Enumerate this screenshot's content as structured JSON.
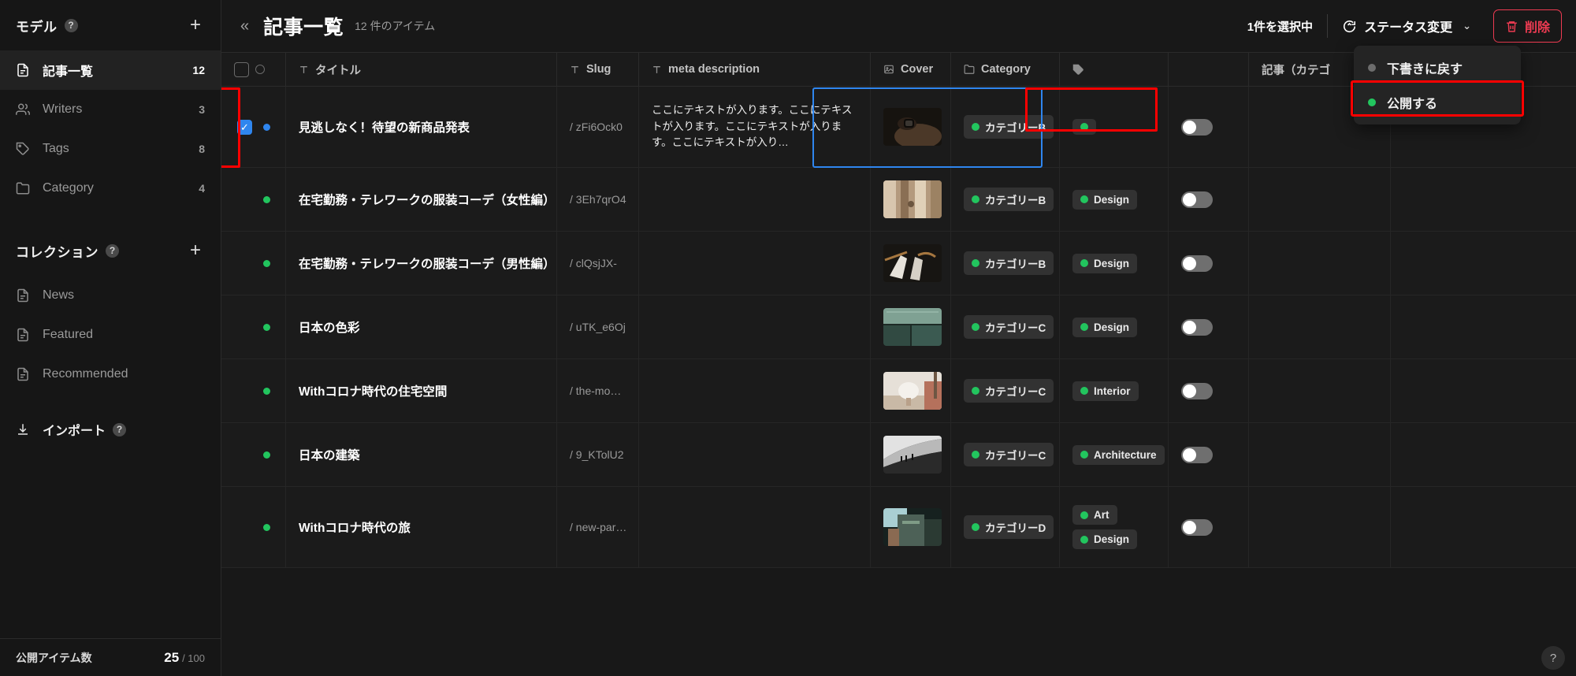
{
  "sidebar": {
    "model_section": {
      "title": "モデル",
      "help_icon": "?",
      "add_icon": "+",
      "items": [
        {
          "label": "記事一覧",
          "count": "12",
          "icon": "document-icon",
          "active": true
        },
        {
          "label": "Writers",
          "count": "3",
          "icon": "users-icon",
          "active": false
        },
        {
          "label": "Tags",
          "count": "8",
          "icon": "tag-icon",
          "active": false
        },
        {
          "label": "Category",
          "count": "4",
          "icon": "folder-icon",
          "active": false
        }
      ]
    },
    "collection_section": {
      "title": "コレクション",
      "help_icon": "?",
      "add_icon": "+",
      "items": [
        {
          "label": "News",
          "count": "",
          "icon": "document-icon",
          "active": false
        },
        {
          "label": "Featured",
          "count": "",
          "icon": "document-icon",
          "active": false
        },
        {
          "label": "Recommended",
          "count": "",
          "icon": "document-icon",
          "active": false
        }
      ]
    },
    "import": {
      "label": "インポート",
      "icon": "download-icon",
      "help_icon": "?"
    },
    "footer": {
      "label": "公開アイテム数",
      "current": "25",
      "max": "/ 100"
    }
  },
  "topbar": {
    "collapse_icon": "«",
    "title": "記事一覧",
    "item_count": "12 件のアイテム",
    "selected_count": "1件を選択中",
    "status_button": {
      "label": "ステータス変更",
      "icon": "status-change-icon",
      "caret": "⌄"
    },
    "delete_button": {
      "label": "削除",
      "icon": "trash-icon"
    }
  },
  "dropdown": {
    "items": [
      {
        "label": "下書きに戻す",
        "dot": "gray"
      },
      {
        "label": "公開する",
        "dot": "green"
      }
    ],
    "highlighted_index": 1,
    "highlight_color": "#ff0000"
  },
  "table": {
    "columns": [
      {
        "key": "check",
        "label": "",
        "icon": ""
      },
      {
        "key": "title",
        "label": "タイトル",
        "icon": "text-type-icon"
      },
      {
        "key": "slug",
        "label": "Slug",
        "icon": "text-type-icon"
      },
      {
        "key": "meta",
        "label": "meta description",
        "icon": "text-type-icon"
      },
      {
        "key": "cover",
        "label": "Cover",
        "icon": "image-icon"
      },
      {
        "key": "cat",
        "label": "Category",
        "icon": "folder-icon"
      },
      {
        "key": "tag",
        "label": "",
        "icon": "tag-icon"
      },
      {
        "key": "tog",
        "label": "",
        "icon": ""
      },
      {
        "key": "rel",
        "label": "記事（カテゴ",
        "icon": ""
      }
    ],
    "rows": [
      {
        "selected": true,
        "status_dot": "blue",
        "title": "見逃しなく！待望の新商品発表",
        "slug": "/ zFi6Ock0",
        "meta": "ここにテキストが入ります。ここにテキストが入ります。ここにテキストが入ります。ここにテキストが入り…",
        "cover": "watch-photo",
        "category": "カテゴリーB",
        "tags": [],
        "toggle": false
      },
      {
        "selected": false,
        "status_dot": "green",
        "title": "在宅勤務・テレワークの服装コーデ（女性編）",
        "slug": "/ 3Eh7qrO4",
        "meta": "",
        "cover": "fabric-photo",
        "category": "カテゴリーB",
        "tags": [
          "Design"
        ],
        "toggle": false
      },
      {
        "selected": false,
        "status_dot": "green",
        "title": "在宅勤務・テレワークの服装コーデ（男性編）",
        "slug": "/ clQsjJX-",
        "meta": "",
        "cover": "hanger-photo",
        "category": "カテゴリーB",
        "tags": [
          "Design"
        ],
        "toggle": false
      },
      {
        "selected": false,
        "status_dot": "green",
        "title": "日本の色彩",
        "slug": "/ uTK_e6Oj",
        "meta": "",
        "cover": "green-wall-photo",
        "category": "カテゴリーC",
        "tags": [
          "Design"
        ],
        "toggle": false
      },
      {
        "selected": false,
        "status_dot": "green",
        "title": "Withコロナ時代の住宅空間",
        "slug": "/ the-mo…",
        "meta": "",
        "cover": "interior-lamp-photo",
        "category": "カテゴリーC",
        "tags": [
          "Interior"
        ],
        "toggle": false
      },
      {
        "selected": false,
        "status_dot": "green",
        "title": "日本の建築",
        "slug": "/ 9_KTolU2",
        "meta": "",
        "cover": "desert-bw-photo",
        "category": "カテゴリーC",
        "tags": [
          "Architecture"
        ],
        "toggle": false
      },
      {
        "selected": false,
        "status_dot": "green",
        "title": "Withコロナ時代の旅",
        "slug": "/ new-par…",
        "meta": "",
        "cover": "city-photo",
        "category": "カテゴリーD",
        "tags": [
          "Art",
          "Design"
        ],
        "toggle": false
      }
    ]
  },
  "help_fab": {
    "icon": "question-icon",
    "label": "?"
  },
  "colors": {
    "accent_blue": "#2f86ef",
    "status_green": "#22c55e",
    "danger_red": "#ef3b52",
    "highlight_red": "#ff0000",
    "bg": "#181818",
    "sidebar_bg": "#161616",
    "row_bg": "#1b1b1b"
  }
}
